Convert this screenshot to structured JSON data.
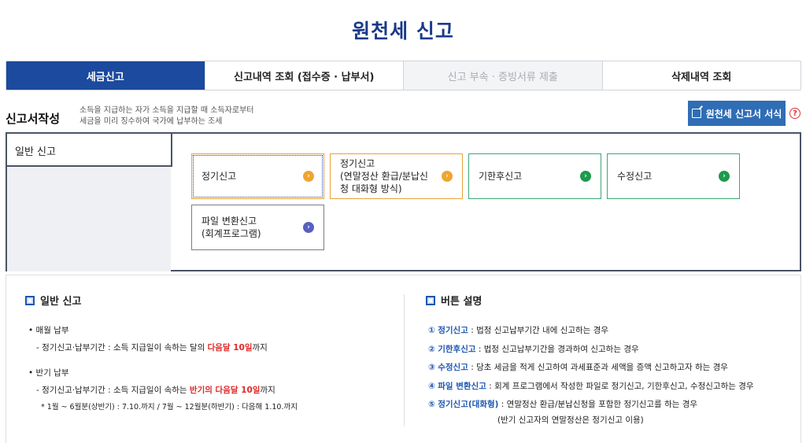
{
  "page_title": "원천세 신고",
  "tabs": [
    {
      "label": "세금신고",
      "state": "active"
    },
    {
      "label": "신고내역 조회 (접수증 · 납부서)",
      "state": "normal"
    },
    {
      "label": "신고 부속 · 증빙서류 제출",
      "state": "disabled"
    },
    {
      "label": "삭제내역 조회",
      "state": "normal"
    }
  ],
  "section": {
    "title": "신고서작성",
    "desc_line1": "소득을 지급하는 자가 소득을 지급할 때 소득자로부터",
    "desc_line2": "세금을 미리 징수하여 국가에 납부하는 조세",
    "form_button": "원천세 신고서 서식",
    "help": "?"
  },
  "report": {
    "tab_label": "일반 신고",
    "options": [
      {
        "label": "정기신고",
        "color": "orange"
      },
      {
        "label": "정기신고 (연말정산 환급/분납신청 대화형 방식)",
        "line1": "정기신고",
        "line2": "(연말정산 환급/분납신",
        "line3": "청 대화형 방식)",
        "color": "orange"
      },
      {
        "label": "기한후신고",
        "color": "green"
      },
      {
        "label": "수정신고",
        "color": "green"
      },
      {
        "label": "파일 변환신고 (회계프로그램)",
        "line1": "파일 변환신고",
        "line2": "(회계프로그램)",
        "color": "purple"
      }
    ]
  },
  "info_left": {
    "heading": "일반 신고",
    "monthly_title": "• 매월 납부",
    "monthly_prefix": "- 정기신고·납부기간 : 소득 지급일이 속하는 달의 ",
    "monthly_red": "다음달 10일",
    "monthly_suffix": "까지",
    "half_title": "• 반기 납부",
    "half_prefix": "- 정기신고·납부기간 : 소득 지급일이 속하는 ",
    "half_red": "반기의 다음달 10일",
    "half_suffix": "까지",
    "half_note": "* 1월 ~ 6월분(상반기) : 7.10.까지 / 7월 ~ 12월분(하반기) : 다음해 1.10.까지"
  },
  "info_right": {
    "heading": "버튼 설명",
    "items": [
      {
        "num": "①",
        "name": "정기신고",
        "desc": " : 법정 신고납부기간 내에 신고하는 경우"
      },
      {
        "num": "②",
        "name": "기한후신고",
        "desc": " : 법정 신고납부기간을 경과하여 신고하는 경우"
      },
      {
        "num": "③",
        "name": "수정신고",
        "desc": " : 당초 세금을 적게 신고하여 과세표준과 세액을 증액 신고하고자 하는 경우"
      },
      {
        "num": "④",
        "name": "파일 변환신고",
        "desc": " : 회계 프로그램에서 작성한 파일로 정기신고, 기한후신고, 수정신고하는 경우"
      },
      {
        "num": "⑤",
        "name": "정기신고(대화형)",
        "desc": " : 연말정산 환급/분납신청을 포함한 정기신고를 하는 경우"
      }
    ],
    "item5_note": "(반기 신고자의 연말정산은 정기신고 이용)"
  },
  "colors": {
    "primary": "#1b4a9e",
    "title": "#1a3a8a",
    "orange": "#f0a52e",
    "green": "#1e9a4e",
    "purple": "#5860c0",
    "red": "#e02828",
    "button": "#2f6db5"
  }
}
